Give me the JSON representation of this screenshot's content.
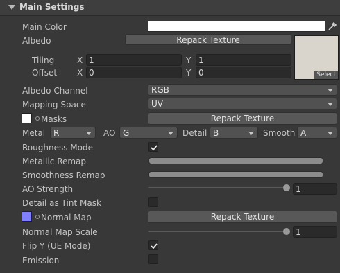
{
  "header": {
    "title": "Main Settings"
  },
  "main_color": {
    "label": "Main Color",
    "color": "#ffffff"
  },
  "albedo": {
    "label": "Albedo",
    "repack_label": "Repack Texture",
    "select_label": "Select",
    "tiling": {
      "label": "Tiling",
      "x_label": "X",
      "x": "1",
      "y_label": "Y",
      "y": "1"
    },
    "offset": {
      "label": "Offset",
      "x_label": "X",
      "x": "0",
      "y_label": "Y",
      "y": "0"
    }
  },
  "albedo_channel": {
    "label": "Albedo Channel",
    "value": "RGB"
  },
  "mapping_space": {
    "label": "Mapping Space",
    "value": "UV"
  },
  "masks": {
    "label": "Masks",
    "repack_label": "Repack Texture"
  },
  "channels": {
    "metal_label": "Metal",
    "metal": "R",
    "ao_label": "AO",
    "ao": "G",
    "detail_label": "Detail",
    "detail": "B",
    "smooth_label": "Smooth",
    "smooth": "A"
  },
  "roughness_mode": {
    "label": "Roughness Mode",
    "checked": true
  },
  "metallic_remap": {
    "label": "Metallic Remap",
    "min": 0,
    "max": 1
  },
  "smoothness_remap": {
    "label": "Smoothness Remap",
    "min": 0,
    "max": 1
  },
  "ao_strength": {
    "label": "AO Strength",
    "value": "1",
    "fraction": 1
  },
  "detail_tint": {
    "label": "Detail as Tint Mask",
    "checked": false
  },
  "normal_map": {
    "label": "Normal Map",
    "swatch_color": "#8080ff",
    "repack_label": "Repack Texture"
  },
  "normal_scale": {
    "label": "Normal Map Scale",
    "value": "1",
    "fraction": 1
  },
  "flip_y": {
    "label": "Flip Y (UE Mode)",
    "checked": true
  },
  "emission": {
    "label": "Emission",
    "checked": false
  },
  "colors": {
    "panel_bg": "#383838",
    "field_bg": "#2a2a2a",
    "button_bg": "#585858"
  }
}
